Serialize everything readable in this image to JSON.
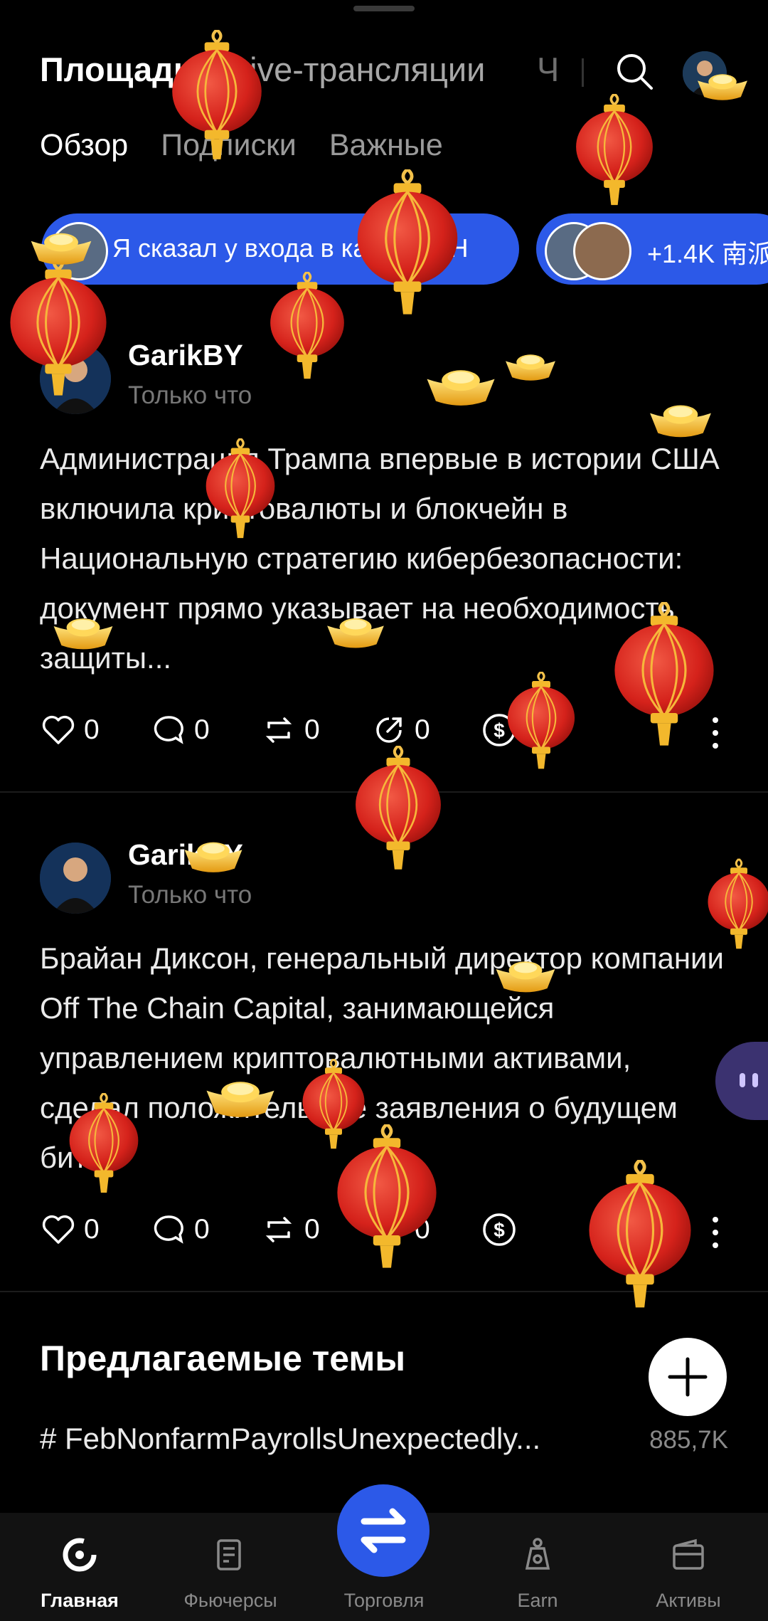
{
  "top_nav": {
    "tab_main": "Площадь",
    "tab_live": "Live-трансляции",
    "tab_more": "Ч"
  },
  "sub_tabs": [
    "Обзор",
    "Подписки",
    "Важные"
  ],
  "live_pills": [
    {
      "text": "Я сказал у входа в казино: «Н"
    },
    {
      "text": "+1.4K 南派"
    }
  ],
  "posts": [
    {
      "author": "GarikBY",
      "time": "Только что",
      "text": "Администрация Трампа впервые в истории США включила криптовалюты и блокчейн в Национальную стратегию кибербезопасности: документ прямо указывает на необходимость защиты...",
      "likes": "0",
      "comments": "0",
      "reposts": "0",
      "shares": "0"
    },
    {
      "author": "GarikBY",
      "time": "Только что",
      "text": "Брайан Диксон, генеральный директор компании Off The Chain Capital, занимающейся управлением криптовалютными активами, сделал положительные заявления о будущем бит…",
      "likes": "0",
      "comments": "0",
      "reposts": "0",
      "shares": "0"
    }
  ],
  "suggested": {
    "title": "Предлагаемые темы",
    "tag": "# FebNonfarmPayrollsUnexpectedly...",
    "count": "885,7K"
  },
  "bottom_nav": [
    {
      "label": "Главная",
      "icon": "home-icon",
      "active": true
    },
    {
      "label": "Фьючерсы",
      "icon": "futures-icon",
      "active": false
    },
    {
      "label": "Торговля",
      "icon": "trade-swap-icon",
      "active": false
    },
    {
      "label": "Earn",
      "icon": "earn-icon",
      "active": false
    },
    {
      "label": "Активы",
      "icon": "wallet-icon",
      "active": false
    }
  ],
  "colors": {
    "accent": "#2c59e8",
    "background": "#000000",
    "lantern": "#d8261f",
    "gold": "#f3b82c"
  }
}
